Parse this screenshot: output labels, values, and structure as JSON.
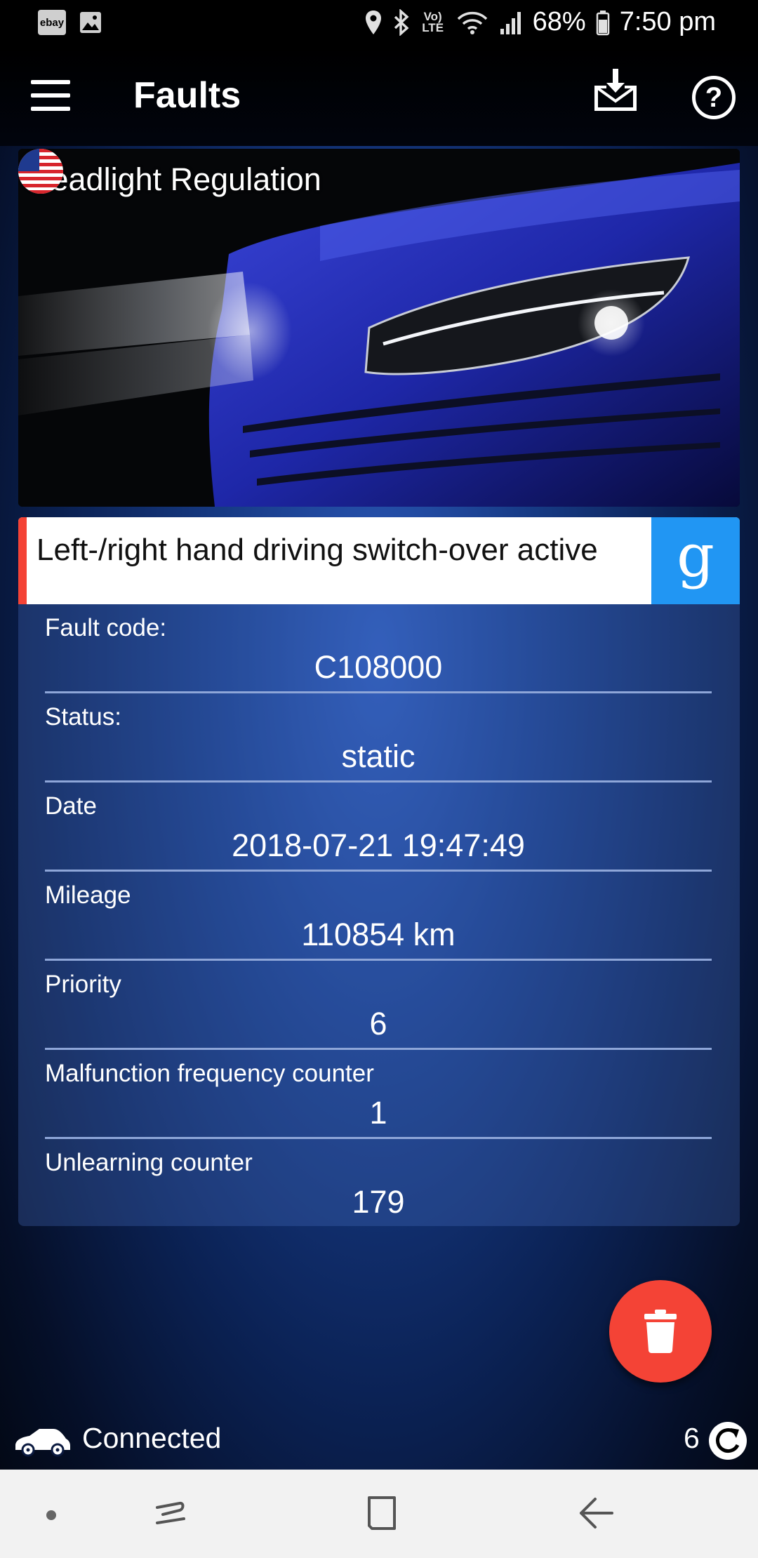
{
  "status_bar": {
    "notification_icons": [
      "ebay-icon",
      "gallery-icon"
    ],
    "ebay_label": "ebay",
    "volte_label": "Vo) LTE",
    "battery": "68%",
    "time": "7:50 pm"
  },
  "app_bar": {
    "title": "Faults",
    "icons": [
      "menu-icon",
      "download-icon",
      "help-icon"
    ],
    "help_glyph": "?"
  },
  "hero": {
    "title": "Headlight Regulation",
    "flag": "us-flag-icon"
  },
  "fault": {
    "title": "Left-/right hand driving switch-over active",
    "search_glyph": "g",
    "accent_color": "#f44336",
    "search_color": "#2196f3"
  },
  "details": [
    {
      "label": "Fault code:",
      "value": "C108000"
    },
    {
      "label": "Status:",
      "value": "static"
    },
    {
      "label": "Date",
      "value": "2018-07-21 19:47:49"
    },
    {
      "label": "Mileage",
      "value": "110854 km"
    },
    {
      "label": "Priority",
      "value": "6"
    },
    {
      "label": "Malfunction frequency counter",
      "value": "1"
    },
    {
      "label": "Unlearning counter",
      "value": "179"
    }
  ],
  "fab": {
    "icon": "trash-icon",
    "color": "#f44336"
  },
  "connection": {
    "status": "Connected",
    "count": "6",
    "icons": [
      "car-icon",
      "refresh-icon"
    ]
  },
  "nav_bar": {
    "buttons": [
      "nav-dot",
      "recent-apps-icon",
      "home-icon",
      "back-icon"
    ]
  }
}
